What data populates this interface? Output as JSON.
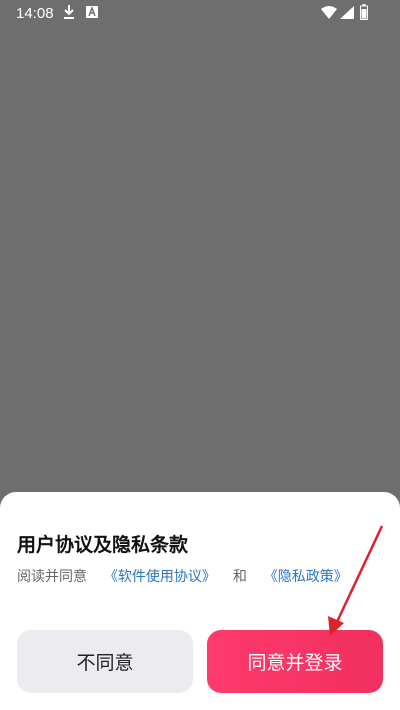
{
  "status_bar": {
    "time": "14:08",
    "icons": [
      "download-icon",
      "a-icon",
      "wifi-icon",
      "signal-icon",
      "battery-icon"
    ]
  },
  "dialog": {
    "title": "用户协议及隐私条款",
    "desc_prefix": "阅读并同意",
    "link_software": "《软件使用协议》",
    "desc_and": "和",
    "link_privacy": "《隐私政策》"
  },
  "buttons": {
    "disagree": "不同意",
    "agree": "同意并登录"
  },
  "colors": {
    "overlay": "#6e6e6e",
    "link": "#2b74c8",
    "agree_button": "#f0305f",
    "disagree_button": "#ecebf0",
    "annotation_arrow": "#e0202a"
  }
}
